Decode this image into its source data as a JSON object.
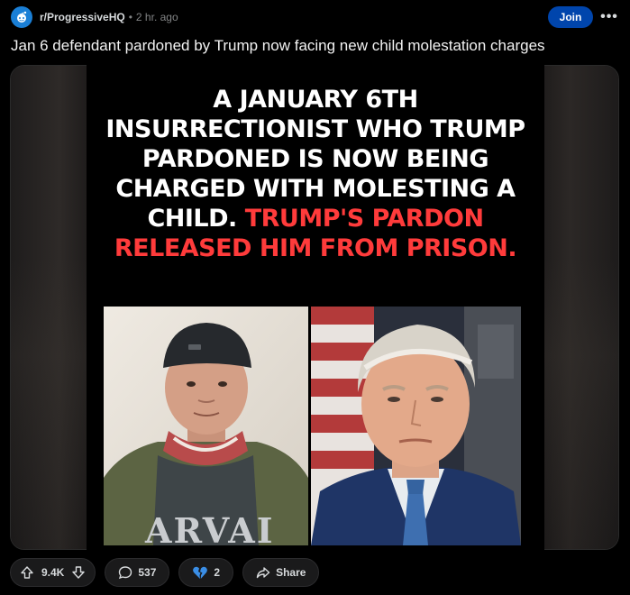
{
  "post": {
    "subreddit": "r/ProgressiveHQ",
    "separator": "•",
    "time": "2 hr. ago",
    "join_label": "Join",
    "more_label": "•••",
    "title": "Jan 6 defendant pardoned by Trump now facing new child molestation charges"
  },
  "image": {
    "line1": "A JANUARY 6TH",
    "line2": "INSURRECTIONIST WHO TRUMP",
    "line3": "PARDONED IS NOW BEING",
    "line4": "CHARGED WITH MOLESTING A",
    "line5_white": "CHILD.",
    "line5_red": "TRUMP'S PARDON",
    "line6_red": "RELEASED HIM FROM PRISON.",
    "shirt_text": "ARVAI"
  },
  "actions": {
    "votes": "9.4K",
    "comments": "537",
    "awards": "2",
    "share": "Share"
  },
  "colors": {
    "join": "#0045ac",
    "avatar": "#1a7fd6",
    "headline_red": "#ff3b3b"
  }
}
